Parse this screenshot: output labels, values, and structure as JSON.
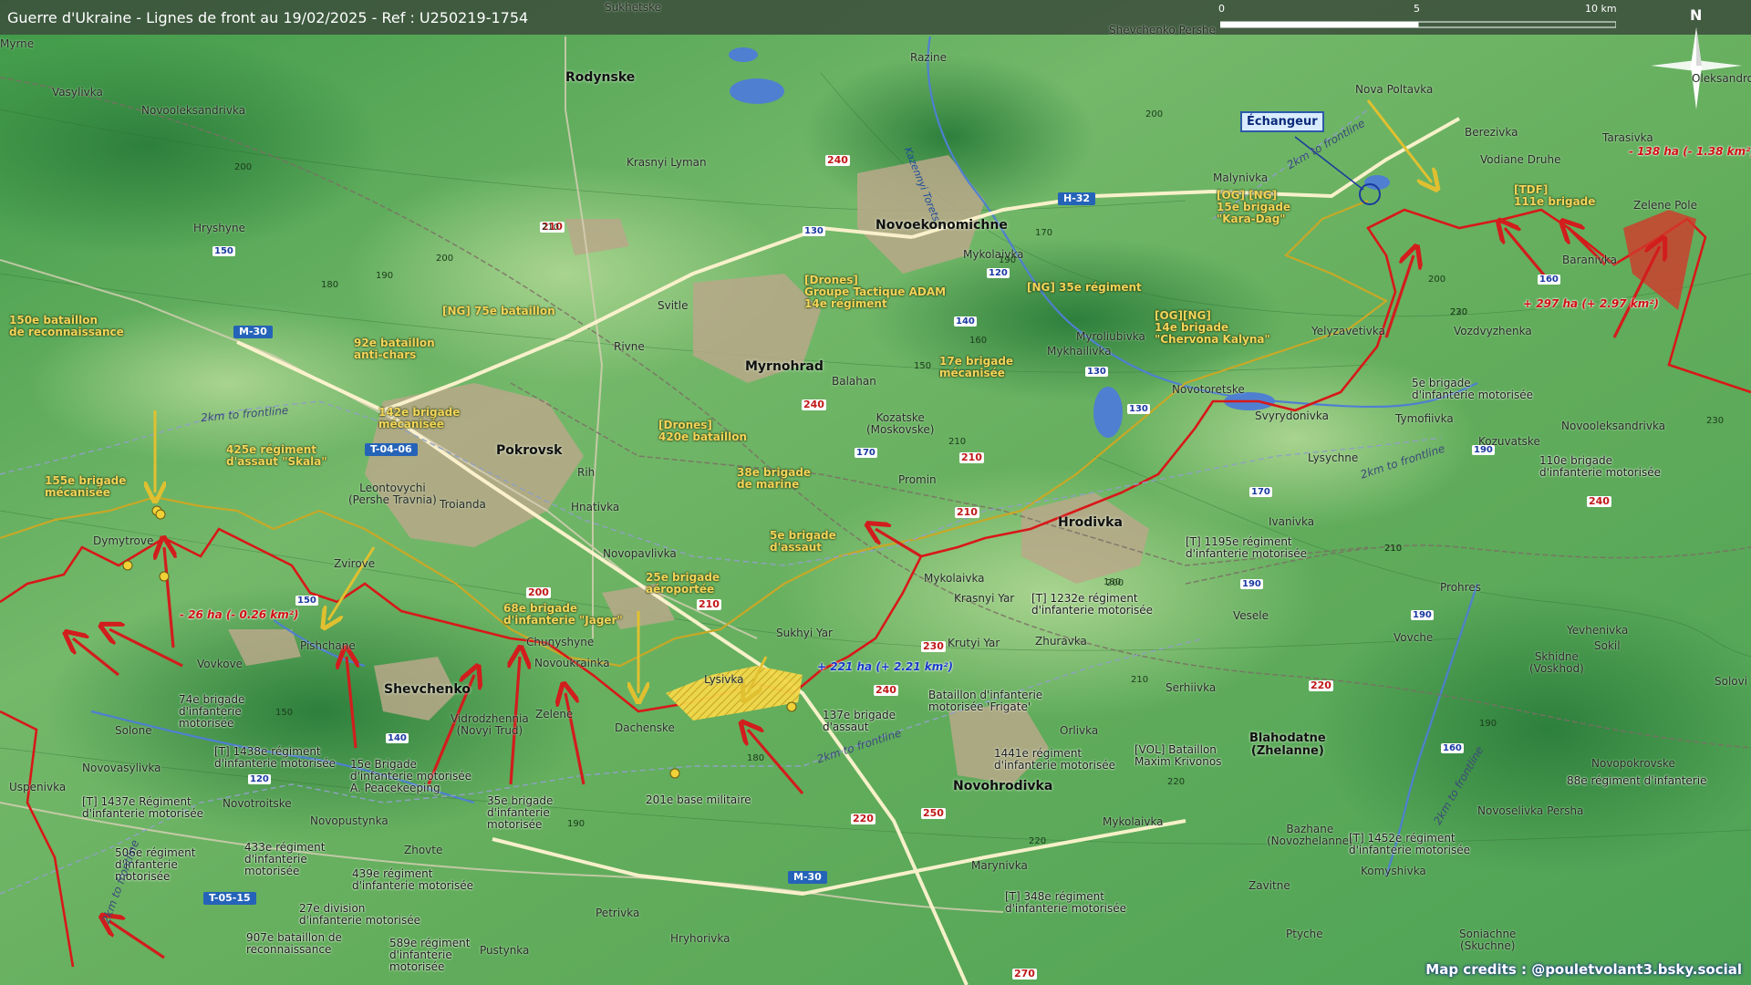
{
  "header": {
    "title": "Guerre d'Ukraine - Lignes de front au 19/02/2025 - Ref : U250219-1754"
  },
  "scale_bar": {
    "labels": [
      "0",
      "5",
      "10 km"
    ]
  },
  "compass": {
    "label": "N"
  },
  "credits": "Map credits : @pouletvolant3.bsky.social",
  "callout": {
    "label": "Échangeur"
  },
  "cities": [
    {
      "id": "pokrovsk",
      "name": "Pokrovsk"
    },
    {
      "id": "myrnohrad",
      "name": "Myrnohrad"
    },
    {
      "id": "novoekonomichne",
      "name": "Novoekonomichne"
    },
    {
      "id": "rodynske",
      "name": "Rodynske"
    },
    {
      "id": "hrodivka",
      "name": "Hrodivka"
    },
    {
      "id": "shevchenko",
      "name": "Shevchenko"
    },
    {
      "id": "novohrodivka",
      "name": "Novohrodivka"
    },
    {
      "id": "blahodatne",
      "name": "Blahodatne\n(Zhelanne)"
    }
  ],
  "towns": [
    "Myrne",
    "Vasylivka",
    "Novooleksandrivka",
    "Sukhetske",
    "Krasnyi Lyman",
    "Razine",
    "Kazennyi Torets",
    "Hryshyne",
    "Svitle",
    "Rivne",
    "Balahan",
    "Kozatske\n(Moskovske)",
    "Promin",
    "Mykolaivka",
    "Malynivka",
    "Nova Poltavka",
    "Berezivka",
    "Vodiane Druhe",
    "Tarasivka",
    "Zelene Pole",
    "Baranivka",
    "Yelyzavetivka",
    "Vozdvyzhenka",
    "Myroliubivka",
    "Mykhailivka",
    "Novotoretske",
    "Svyrydonivka",
    "Tymofiivka",
    "Lysychne",
    "Kozuvatske",
    "Novooleksandrivka",
    "Leontovychi\n(Pershe Travnia)",
    "Troianda",
    "Hnativka",
    "Rih",
    "Novopavlivka",
    "Dymytrove",
    "Zvirove",
    "Pishchane",
    "Vovkove",
    "Solone",
    "Novovasylivka",
    "Uspenivka",
    "Novotroitske",
    "Novopustynka",
    "Zhovte",
    "Chunyshyne",
    "Novoukrainka",
    "Zelene",
    "Vidrodzhennia\n(Novyi Trud)",
    "Dachenske",
    "Lysivka",
    "Sukhyi Yar",
    "Mykolaivka",
    "Krasnyi Yar",
    "Krutyi Yar",
    "Zhuravka",
    "Ivanivka",
    "Vesele",
    "Serhiivka",
    "Orlivka",
    "Mykolaivka",
    "Marynivka",
    "Petrivka",
    "Hryhorivka",
    "Pustynka",
    "Bazhane\n(Novozhelanne)",
    "Zavitne",
    "Komyshivka",
    "Ptyche",
    "Soniachne\n(Skuchne)",
    "Prohres",
    "Vovche",
    "Yevhenivka",
    "Sokil",
    "Skhidne\n(Voskhod)",
    "Solovi",
    "Novopokrovske",
    "Novoselivka Persha",
    "Shevchenko Pershe",
    "Oleksandropil"
  ],
  "ukraine_units": [
    "150e bataillon\nde reconnaissance",
    "92e bataillon\nanti-chars",
    "[NG] 75e bataillon",
    "[Drones]\nGroupe Tactique ADAM\n14e régiment",
    "142e brigade\nmécanisée",
    "[Drones]\n420e bataillon",
    "425e régiment\nd'assaut \"Skala\"",
    "155e brigade\nmécanisée",
    "38e brigade\nde marine",
    "5e brigade\nd'assaut",
    "25e brigade\naéroportée",
    "68e brigade\nd'infanterie \"Jager\"",
    "[NG] 35e régiment",
    "17e brigade\nmécanisée",
    "[OG][NG]\n14e brigade\n\"Chervona Kalyna\"",
    "[OG] [NG]\n15e brigade\n\"Kara-Dag\"",
    "[TDF]\n111e brigade"
  ],
  "russia_units": [
    "5e brigade\nd'infanterie motorisée",
    "110e brigade\nd'infanterie motorisée",
    "[T] 1195e régiment\nd'infanterie motorisée",
    "[T] 1232e régiment\nd'infanterie motorisée",
    "Bataillon d'infanterie\nmotorisée 'Frigate'",
    "137e brigade\nd'assaut",
    "1441e régiment\nd'infanterie motorisée",
    "[VOL] Bataillon\nMaxim Krivonos",
    "74e brigade\nd'infanterie\nmotorisée",
    "[T] 1438e régiment\nd'infanterie motorisée",
    "15e Brigade\nd'infanterie motorisée\nA. Peacekeeping",
    "35e brigade\nd'infanterie\nmotorisée",
    "201e base militaire",
    "[T] 1437e Régiment\nd'infanterie motorisée",
    "506e régiment\nd'infanterie\nmotorisée",
    "433e régiment\nd'infanterie\nmotorisée",
    "439e régiment\nd'infanterie motorisée",
    "27e division\nd'infanterie motorisée",
    "907e bataillon de\nreconnaissance",
    "589e régiment\nd'infanterie\nmotorisée",
    "[T] 348e régiment\nd'infanterie motorisée",
    "[T] 1452e régiment\nd'infanterie motorisée",
    "88e régiment d'infanterie"
  ],
  "area_changes": [
    {
      "text": "- 138 ha (- 1.38 km²)",
      "color": "#d01010"
    },
    {
      "text": "+ 297 ha (+ 2.97 km²)",
      "color": "#d01010"
    },
    {
      "text": "- 26 ha (- 0.26 km²)",
      "color": "#d01010"
    },
    {
      "text": "+ 221 ha (+ 2.21 km²)",
      "color": "#1438c8"
    }
  ],
  "frontline_distance_labels": [
    "2km to frontline",
    "2km to frontline",
    "2km to frontline",
    "2km to frontline",
    "2km to frontline",
    "2km to frontline"
  ],
  "highways": [
    "H-32",
    "M-30",
    "M-30",
    "T-04-06",
    "T-05-15"
  ],
  "road_numbers": [
    "240",
    "210",
    "130",
    "120",
    "140",
    "130",
    "130",
    "170",
    "170",
    "240",
    "210",
    "210",
    "200",
    "210",
    "230",
    "240",
    "250",
    "220",
    "270",
    "220",
    "240",
    "160",
    "190",
    "150",
    "120",
    "140",
    "150",
    "190",
    "160",
    "190"
  ],
  "heights": [
    "200",
    "210",
    "150",
    "190",
    "180",
    "200",
    "170",
    "190",
    "200",
    "210",
    "160",
    "150",
    "180",
    "200",
    "220",
    "210",
    "220",
    "230",
    "210",
    "190",
    "230",
    "220",
    "200",
    "210",
    "190",
    "180"
  ],
  "colors": {
    "russia_line": "#d81818",
    "ukraine_line": "#c9a826",
    "russian_gain": "#d23a2a",
    "ukrainian_gain": "#f3d84a",
    "terrain": "#5aa85a",
    "water": "#4f7fd0"
  }
}
